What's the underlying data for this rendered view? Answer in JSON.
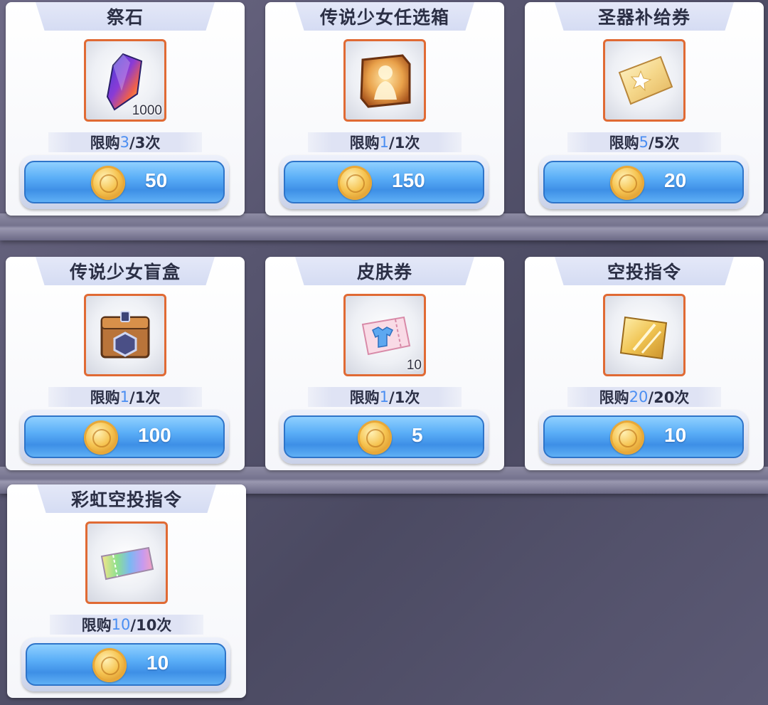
{
  "shop": {
    "items": [
      {
        "name": "祭石",
        "quantity": "1000",
        "limit_prefix": "限购",
        "limit_current": "3",
        "limit_suffix": "/3次",
        "price": "50",
        "icon": "prism-crystal-icon"
      },
      {
        "name": "传说少女任选箱",
        "quantity": "",
        "limit_prefix": "限购",
        "limit_current": "1",
        "limit_suffix": "/1次",
        "price": "150",
        "icon": "golden-silhouette-box-icon"
      },
      {
        "name": "圣器补给券",
        "quantity": "",
        "limit_prefix": "限购",
        "limit_current": "5",
        "limit_suffix": "/5次",
        "price": "20",
        "icon": "supply-ticket-icon"
      },
      {
        "name": "传说少女盲盒",
        "quantity": "",
        "limit_prefix": "限购",
        "limit_current": "1",
        "limit_suffix": "/1次",
        "price": "100",
        "icon": "mystery-chest-icon"
      },
      {
        "name": "皮肤券",
        "quantity": "10",
        "limit_prefix": "限购",
        "limit_current": "1",
        "limit_suffix": "/1次",
        "price": "5",
        "icon": "skin-ticket-icon"
      },
      {
        "name": "空投指令",
        "quantity": "",
        "limit_prefix": "限购",
        "limit_current": "20",
        "limit_suffix": "/20次",
        "price": "10",
        "icon": "airdrop-card-icon"
      },
      {
        "name": "彩虹空投指令",
        "quantity": "",
        "limit_prefix": "限购",
        "limit_current": "10",
        "limit_suffix": "/10次",
        "price": "10",
        "icon": "rainbow-ticket-icon"
      }
    ],
    "currency_icon": "gold-coin-icon",
    "colors": {
      "frame": "#e06a34",
      "button": "#4b9bf0",
      "limit_highlight": "#4b8ef2"
    }
  }
}
